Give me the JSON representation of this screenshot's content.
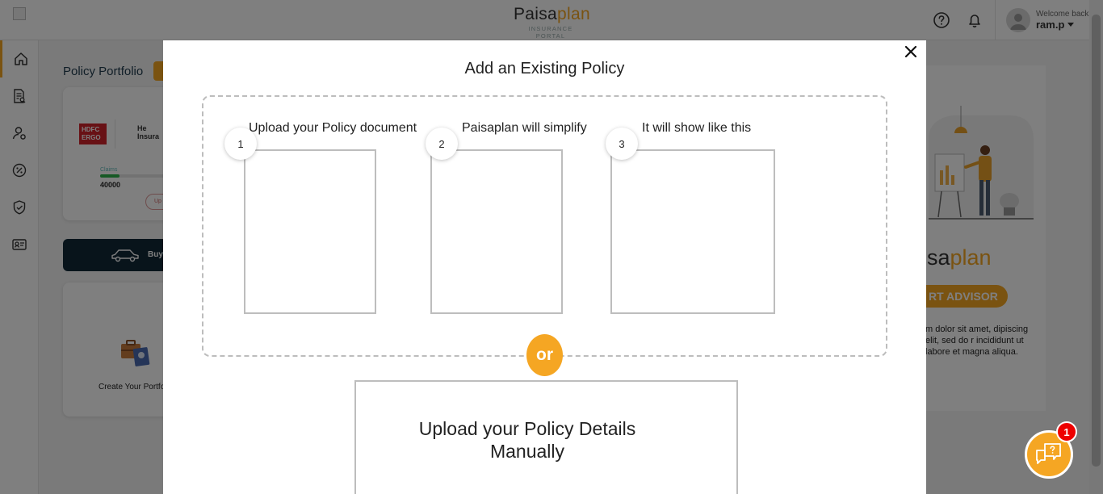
{
  "header": {
    "brand_part1": "Paisa",
    "brand_part2": "plan",
    "brand_sub": "INSURANCE PORTAL",
    "welcome_text": "Welcome back",
    "username": "ram.p"
  },
  "sidebar": {
    "items": [
      "home-icon",
      "policy-document-icon",
      "user-settings-icon",
      "discount-icon",
      "shield-check-icon",
      "id-card-icon"
    ],
    "active_index": 0
  },
  "background": {
    "portfolio_title": "Policy Portfolio",
    "policy_card": {
      "insurer_logo_text": "HDFC ERGO",
      "insurer_name_line1": "He",
      "insurer_name_line2": "Insura",
      "claims_label": "Claims",
      "claims_amount": "40000",
      "upload_label": "Up"
    },
    "buy_label": "Buy",
    "create_label": "Create Your Portfo",
    "right_card": {
      "brand_part1": "sa",
      "brand_part2": "plan",
      "advisor_label": "RT ADVISOR",
      "lorem": "m dolor sit amet, dipiscing elit, sed do r incididunt ut labore et magna aliqua."
    }
  },
  "modal": {
    "title": "Add an Existing Policy",
    "steps": [
      {
        "number": "1",
        "label": "Upload your Policy document"
      },
      {
        "number": "2",
        "label": "Paisaplan will simplify"
      },
      {
        "number": "3",
        "label": "It will show like this"
      }
    ],
    "or_label": "or",
    "manual_line1": "Upload your Policy Details",
    "manual_line2": "Manually"
  },
  "chat": {
    "badge_count": "1"
  },
  "colors": {
    "accent": "#f5a623",
    "dark_navy": "#102837",
    "badge_red": "#e00000"
  }
}
